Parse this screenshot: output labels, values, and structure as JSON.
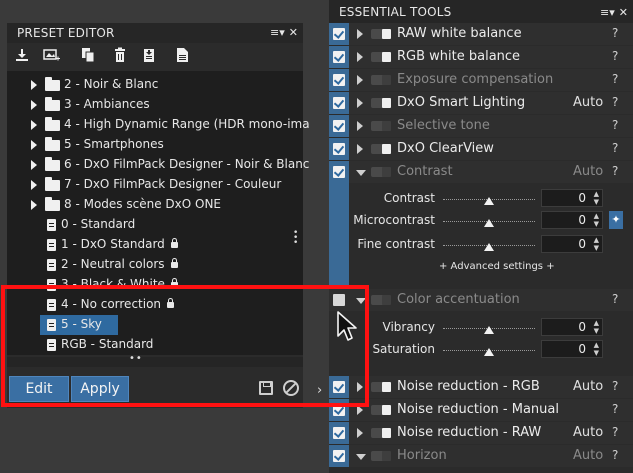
{
  "preset_editor": {
    "title": "PRESET EDITOR",
    "window_controls": [
      "≡▾",
      "✕"
    ],
    "toolbar_icons": [
      "import-icon",
      "new-preset-icon",
      "duplicate-icon",
      "delete-icon",
      "export-icon",
      "settings-file-icon"
    ],
    "folders": [
      {
        "label": "2 - Noir & Blanc"
      },
      {
        "label": "3 - Ambiances"
      },
      {
        "label": "4 - High Dynamic Range (HDR mono-ima"
      },
      {
        "label": "5 - Smartphones"
      },
      {
        "label": "6 - DxO FilmPack Designer - Noir & Blanc"
      },
      {
        "label": "7 - DxO FilmPack Designer - Couleur"
      },
      {
        "label": "8 - Modes scène DxO ONE"
      }
    ],
    "presets": [
      {
        "label": "0 - Standard",
        "locked": false
      },
      {
        "label": "1 - DxO Standard",
        "locked": true
      },
      {
        "label": "2 - Neutral colors",
        "locked": true
      },
      {
        "label": "3 - Black & White",
        "locked": true
      },
      {
        "label": "4 - No correction",
        "locked": true
      },
      {
        "label": "5 - Sky",
        "locked": false,
        "selected": true
      },
      {
        "label": "RGB - Standard",
        "locked": false
      }
    ],
    "edit_label": "Edit",
    "apply_label": "Apply",
    "collapse_glyph": "›"
  },
  "essential_tools": {
    "title": "ESSENTIAL TOOLS",
    "window_controls": [
      "≡▾",
      "✕"
    ],
    "tools": [
      {
        "name": "RAW white balance",
        "checked": true,
        "enabled": true,
        "auto": "",
        "help": "?"
      },
      {
        "name": "RGB white balance",
        "checked": true,
        "enabled": true,
        "auto": "",
        "help": "?"
      },
      {
        "name": "Exposure compensation",
        "checked": true,
        "enabled": false,
        "auto": "",
        "help": "?"
      },
      {
        "name": "DxO Smart Lighting",
        "checked": true,
        "enabled": true,
        "auto": "Auto",
        "help": "?"
      },
      {
        "name": "Selective tone",
        "checked": true,
        "enabled": false,
        "auto": "",
        "help": "?"
      },
      {
        "name": "DxO ClearView",
        "checked": true,
        "enabled": true,
        "auto": "",
        "help": "?"
      },
      {
        "name": "Contrast",
        "checked": true,
        "enabled": false,
        "auto": "Auto",
        "help": "?",
        "expanded": true
      },
      {
        "name": "Color accentuation",
        "checked": false,
        "enabled": false,
        "auto": "",
        "help": "?",
        "expanded": true
      },
      {
        "name": "Noise reduction - RGB",
        "checked": true,
        "enabled": true,
        "auto": "Auto",
        "help": "?"
      },
      {
        "name": "Noise reduction - Manual",
        "checked": true,
        "enabled": true,
        "auto": "",
        "help": "?"
      },
      {
        "name": "Noise reduction - RAW",
        "checked": true,
        "enabled": true,
        "auto": "Auto",
        "help": "?"
      },
      {
        "name": "Horizon",
        "checked": true,
        "enabled": false,
        "auto": "Auto",
        "help": "?",
        "expanded": true
      }
    ],
    "contrast": {
      "sliders": [
        {
          "label": "Contrast",
          "value": "0",
          "position": 0.5
        },
        {
          "label": "Microcontrast",
          "value": "0",
          "position": 0.5
        },
        {
          "label": "Fine contrast",
          "value": "0",
          "position": 0.5
        }
      ],
      "advanced_label": "+ Advanced settings +"
    },
    "color_accentuation": {
      "sliders": [
        {
          "label": "Vibrancy",
          "value": "0",
          "position": 0.5
        },
        {
          "label": "Saturation",
          "value": "0",
          "position": 0.5
        }
      ]
    }
  }
}
